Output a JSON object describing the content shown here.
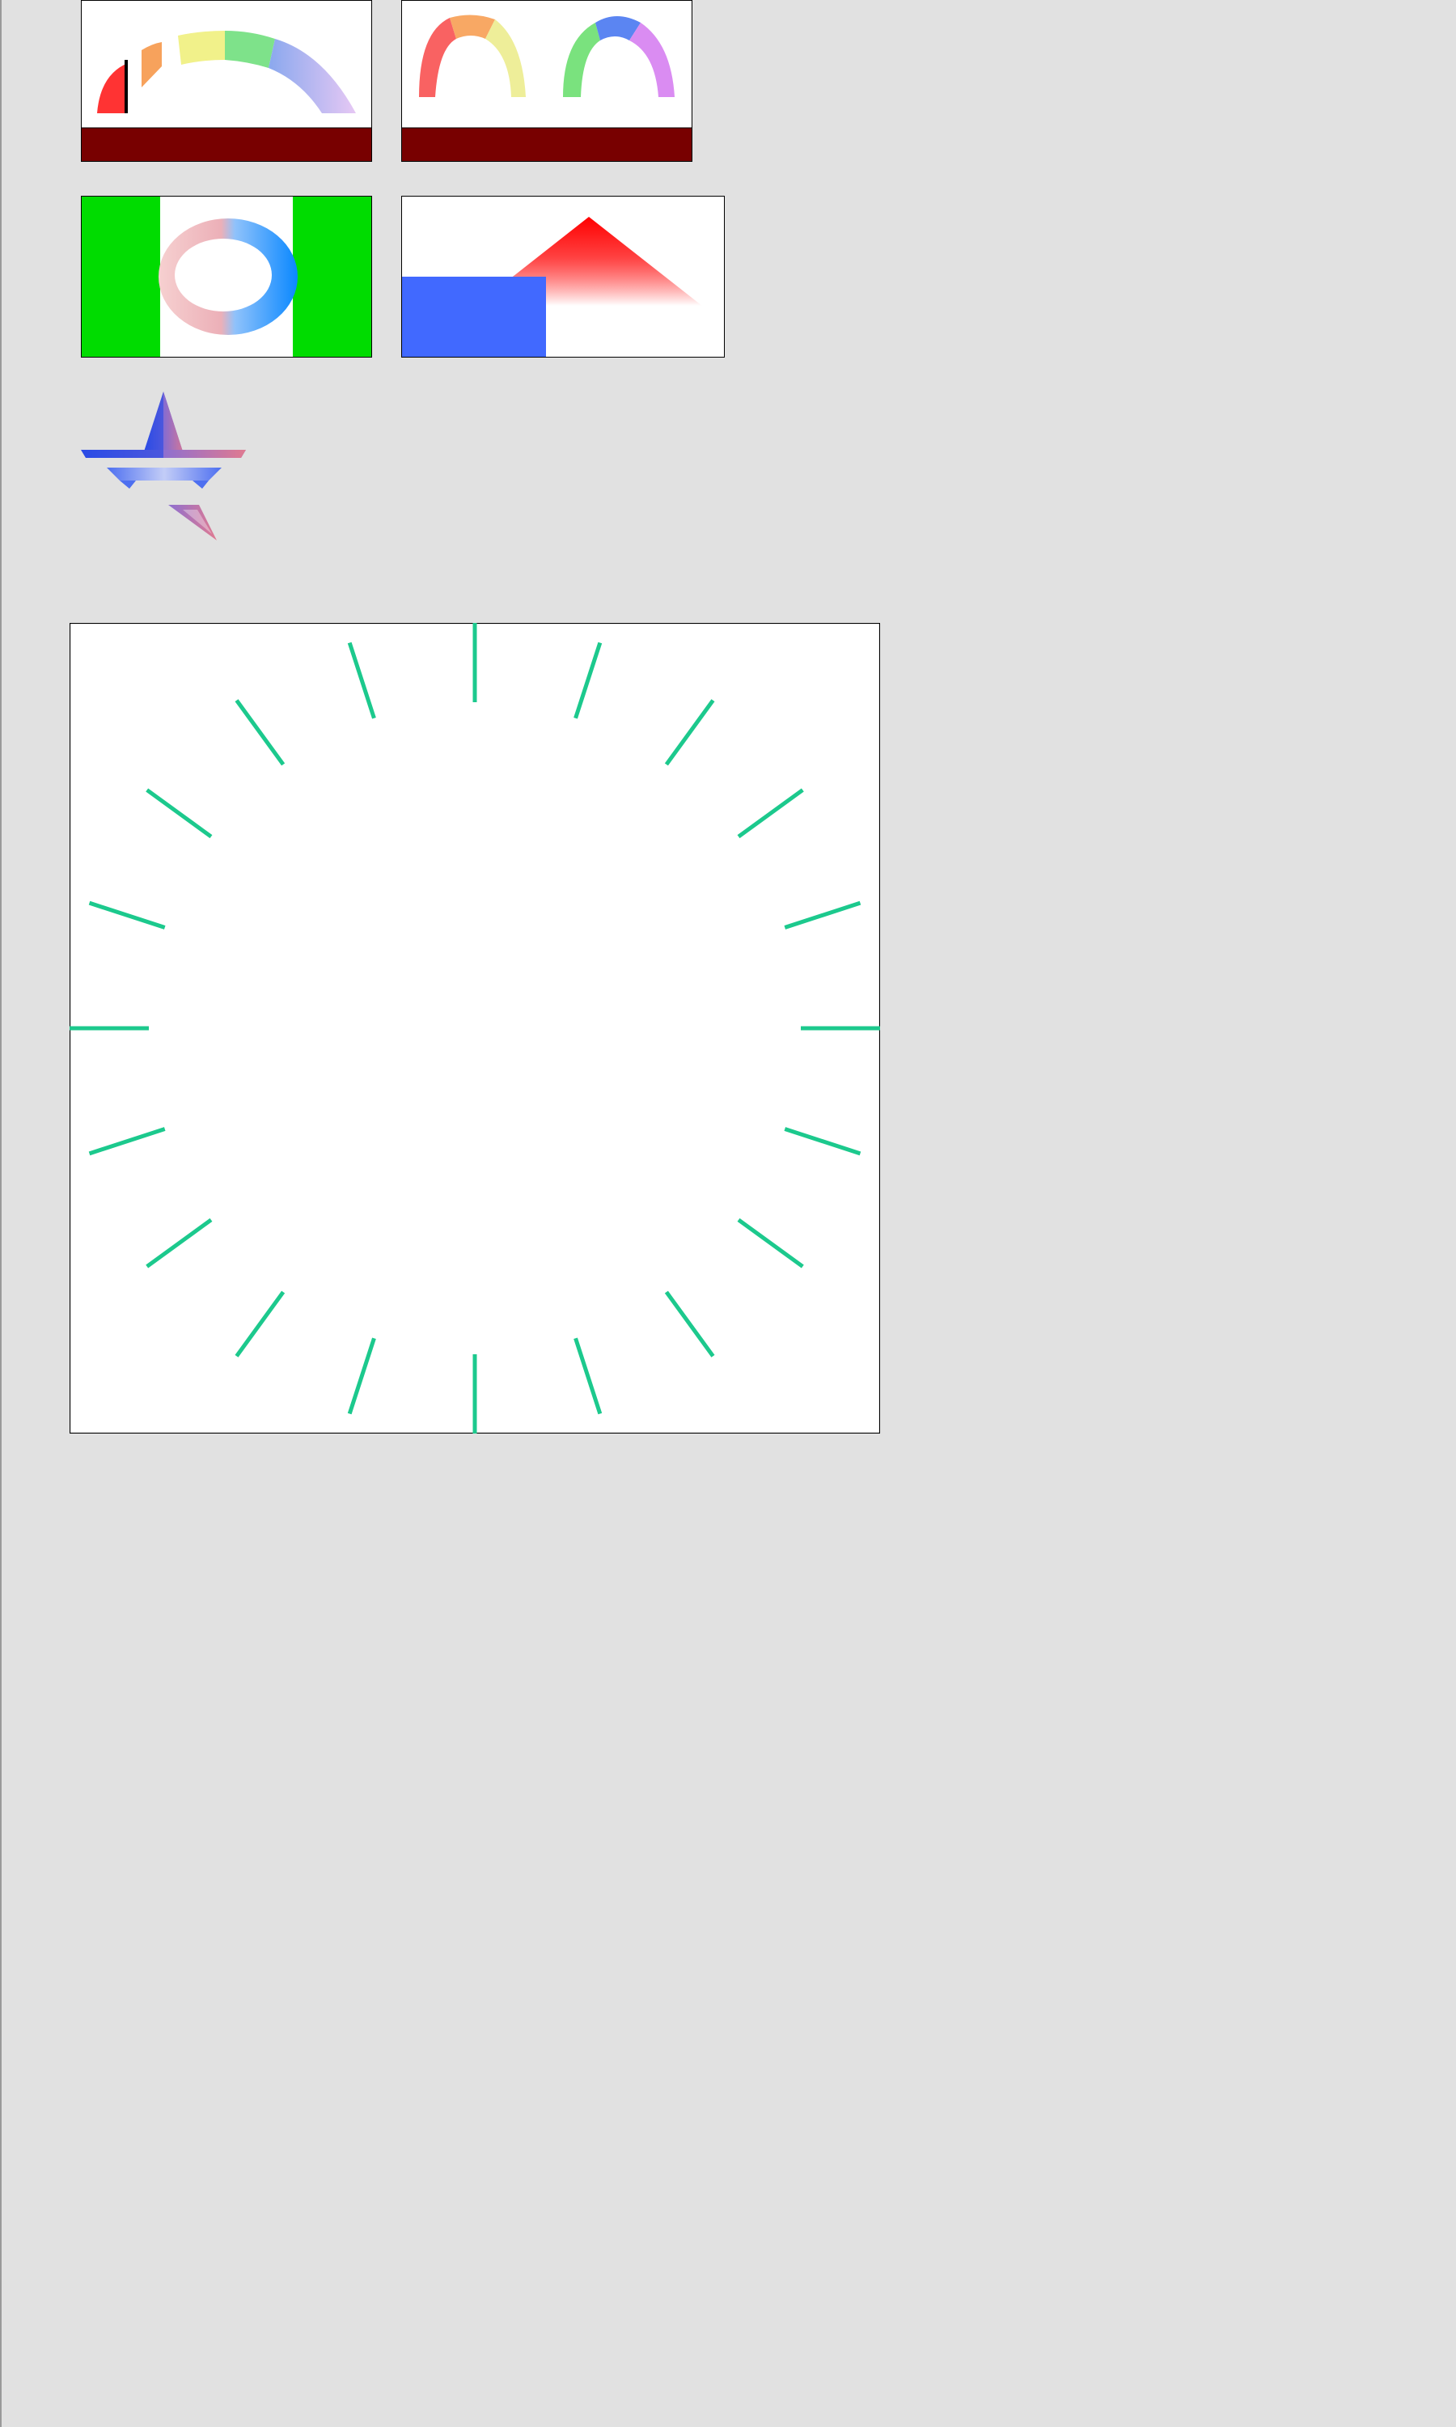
{
  "canvas": {
    "background": "#e1e1e1",
    "border": "#000000"
  },
  "panels": [
    {
      "id": "arc-bands",
      "shape": "segmented-arc",
      "band_colors": [
        "#ff3333",
        "#f7a25c",
        "#f1f18a",
        "#7ee28a",
        "#8aa8ee",
        "#e6c8f4"
      ],
      "base_bar_color": "#780000"
    },
    {
      "id": "twin-arches",
      "shape": "two-arches",
      "left_arch_colors": [
        "#f96262",
        "#f8a864",
        "#eeee99"
      ],
      "right_arch_colors": [
        "#7ae27e",
        "#5b85f2",
        "#da8cf2"
      ],
      "base_bar_color": "#780000"
    },
    {
      "id": "ring",
      "shape": "ellipse-ring",
      "side_block_color": "#00dc00",
      "ring_colors": [
        "#f2b8b8",
        "#0a88ff"
      ]
    },
    {
      "id": "shapes",
      "shape": "triangle-and-rectangle",
      "triangle_color": "#ff0000",
      "rectangle_color": "#4169ff"
    },
    {
      "id": "star",
      "shape": "five-point-star",
      "colors": [
        "#2a4be6",
        "#e07a90",
        "#a9b8f4"
      ]
    },
    {
      "id": "dial",
      "shape": "radial-ticks",
      "tick_count": 20,
      "tick_color": "#1cc98d",
      "background": "#ffffff"
    }
  ]
}
